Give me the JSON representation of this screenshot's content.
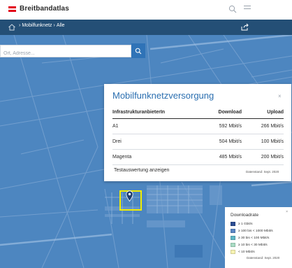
{
  "app": {
    "brand": "Breitbandatlas"
  },
  "colors": {
    "flag_red": "#e2001a",
    "nav": "#244f76",
    "accent": "#2f73b7",
    "map_fill": "#4d86c0",
    "selection": "#f2ee00"
  },
  "icons": {
    "top_search": "search-icon",
    "top_menu": "menu-icon",
    "home": "home-icon",
    "share": "share-icon",
    "search": "search-icon",
    "marker": "map-marker-icon"
  },
  "breadcrumb": {
    "items": [
      "Mobilfunknetz",
      "Alle"
    ],
    "separator": "›"
  },
  "search": {
    "placeholder": "Ort, Adresse...",
    "value": ""
  },
  "popup": {
    "title": "Mobilfunknetzversorgung",
    "close": "×",
    "columns": [
      "InfrastrukturanbieterIn",
      "Download",
      "Upload"
    ],
    "rows": [
      {
        "provider": "A1",
        "download": "592 Mbit/s",
        "upload": "266 Mbit/s"
      },
      {
        "provider": "Drei",
        "download": "504 Mbit/s",
        "upload": "100 Mbit/s"
      },
      {
        "provider": "Magenta",
        "download": "485 Mbit/s",
        "upload": "200 Mbit/s"
      }
    ],
    "link": "Testauswertung anzeigen",
    "date": "Datenstand: Sept. 2020"
  },
  "legend": {
    "title": "Downloadrate",
    "close": "×",
    "items": [
      {
        "label": "≥ 1 Gbit/s",
        "color": "#2d4e93"
      },
      {
        "label": "≥ 100 bis < 1000 Mbit/s",
        "color": "#5b86c4"
      },
      {
        "label": "≥ 30 bis < 100 Mbit/s",
        "color": "#5fb7c6"
      },
      {
        "label": "≥ 10 bis < 30 Mbit/s",
        "color": "#a9dcc4"
      },
      {
        "label": "< 10 Mbit/s",
        "color": "#f7f3b2"
      }
    ],
    "date": "Datenstand: Sept. 2020"
  }
}
